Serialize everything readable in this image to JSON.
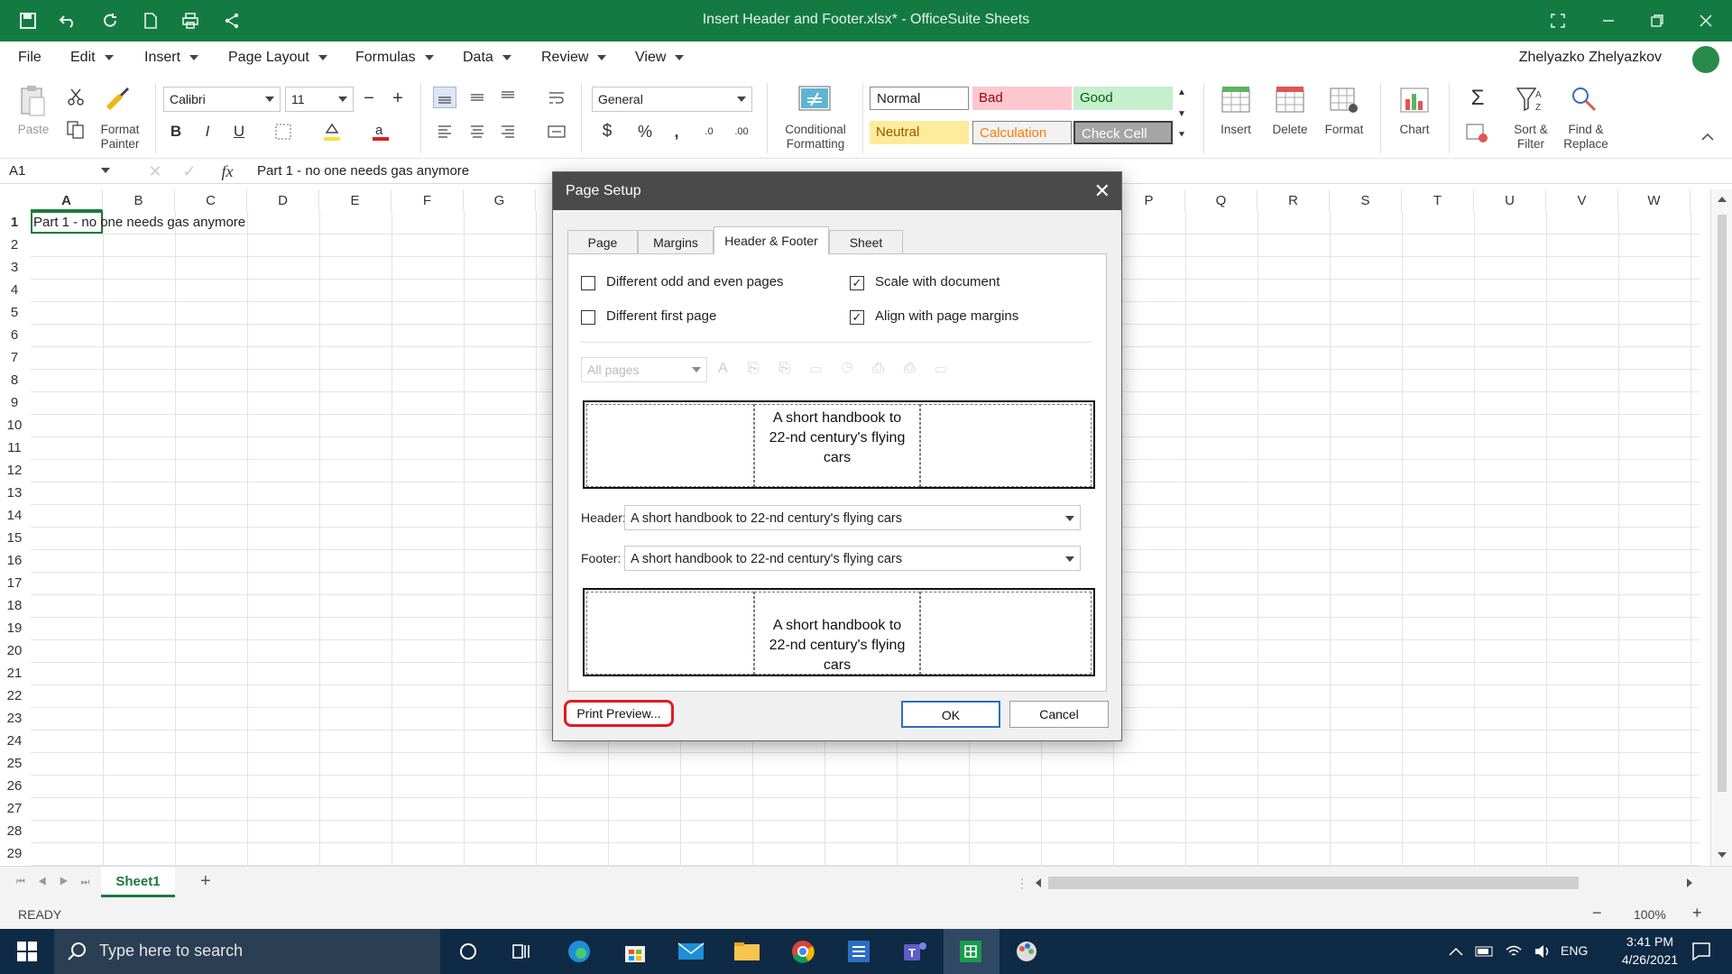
{
  "window": {
    "title": "Insert Header and Footer.xlsx* - OfficeSuite Sheets"
  },
  "menu": {
    "items": [
      "File",
      "Edit",
      "Insert",
      "Page Layout",
      "Formulas",
      "Data",
      "Review",
      "View"
    ],
    "user": "Zhelyazko Zhelyazkov"
  },
  "ribbon": {
    "paste": "Paste",
    "format_painter": "Format\nPainter",
    "font_name": "Calibri",
    "font_size": "11",
    "number_format": "General",
    "conditional_formatting": "Conditional\nFormatting",
    "styles": {
      "normal": "Normal",
      "bad": "Bad",
      "good": "Good",
      "neutral": "Neutral",
      "calculation": "Calculation",
      "check_cell": "Check Cell"
    },
    "insert": "Insert",
    "delete": "Delete",
    "format": "Format",
    "chart": "Chart",
    "sort_filter": "Sort &\nFilter",
    "find_replace": "Find &\nReplace",
    "colors": {
      "bad_bg": "#fcc7ce",
      "bad_fg": "#9c0006",
      "good_bg": "#c6efce",
      "good_fg": "#006100",
      "neutral_bg": "#ffeb9c",
      "neutral_fg": "#9c5700",
      "check_bg": "#a5a5a5"
    }
  },
  "formula_bar": {
    "name_box": "A1",
    "fx": "fx",
    "content": "Part 1 - no one needs gas anymore"
  },
  "sheet": {
    "columns": [
      "A",
      "B",
      "C",
      "D",
      "E",
      "F",
      "G",
      "H",
      "I",
      "J",
      "K",
      "L",
      "M",
      "N",
      "O",
      "P",
      "Q",
      "R",
      "S",
      "T",
      "U",
      "V",
      "W"
    ],
    "rows": [
      "1",
      "2",
      "3",
      "4",
      "5",
      "6",
      "7",
      "8",
      "9",
      "10",
      "11",
      "12",
      "13",
      "14",
      "15",
      "16",
      "17",
      "18",
      "19",
      "20",
      "21",
      "22",
      "23",
      "24",
      "25",
      "26",
      "27",
      "28",
      "29"
    ],
    "a1_value": "Part 1 - no one needs gas anymore",
    "tab": "Sheet1",
    "add_tab": "+"
  },
  "status": {
    "ready": "READY",
    "zoom": "100%",
    "minus": "−",
    "plus": "+"
  },
  "dialog": {
    "title": "Page Setup",
    "tabs": [
      "Page",
      "Margins",
      "Header & Footer",
      "Sheet"
    ],
    "active_tab": "Header & Footer",
    "options": {
      "odd_even": "Different odd and even pages",
      "first_page": "Different first page",
      "scale": "Scale with document",
      "align": "Align with page margins"
    },
    "checked": {
      "odd_even": false,
      "first_page": false,
      "scale": true,
      "align": true
    },
    "pages_select": "All pages",
    "header_preview": "A short handbook to\n22-nd century's flying\ncars",
    "header_label": "Header:",
    "header_value": "A short handbook to 22-nd century's flying cars",
    "footer_label": "Footer:",
    "footer_value": "A short handbook to 22-nd century's flying cars",
    "footer_preview": "A short handbook to\n22-nd century's flying\ncars",
    "print_preview": "Print Preview...",
    "ok": "OK",
    "cancel": "Cancel"
  },
  "taskbar": {
    "search_placeholder": "Type here to search",
    "lang": "ENG",
    "time": "3:41 PM",
    "date": "4/26/2021"
  }
}
